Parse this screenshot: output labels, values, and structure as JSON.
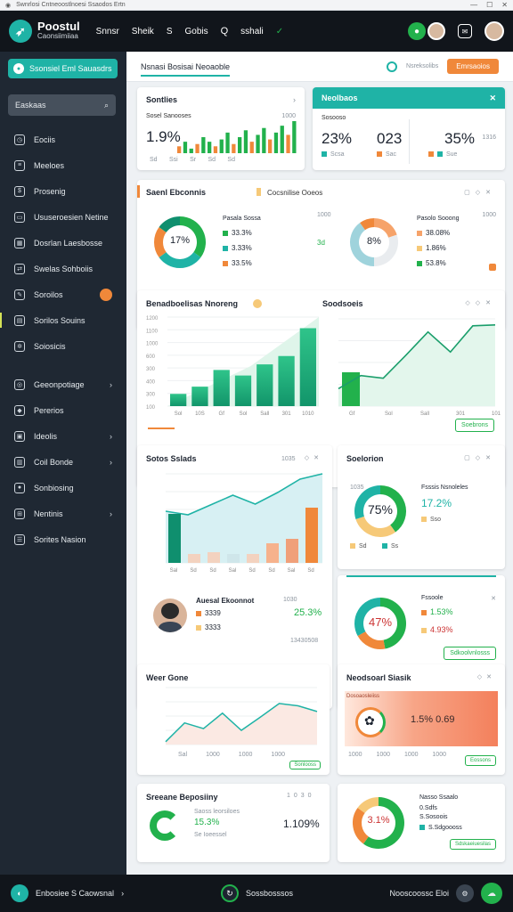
{
  "window": {
    "title": "Swnrlosi Cntneoostlnoesi Ssaodos Ertn"
  },
  "topbar": {
    "brand_name": "Poostul",
    "brand_sub": "Caonsiimiiaa",
    "nav": [
      "Snnsr",
      "Sheik",
      "S",
      "Gobis",
      "Q",
      "sshali"
    ],
    "check": "✓"
  },
  "sidebar": {
    "primary_label": "Ssonsiel Eml Sauasdrs",
    "search_placeholder": "Easkaas",
    "items": [
      {
        "label": "Eociis",
        "icon": "history-icon"
      },
      {
        "label": "Meeloes",
        "icon": "document-icon"
      },
      {
        "label": "Prosenig",
        "icon": "wallet-icon"
      },
      {
        "label": "Ususeroesien Netine",
        "icon": "monitor-icon"
      },
      {
        "label": "Dosrlan Laesbosse",
        "icon": "calendar-icon"
      },
      {
        "label": "Swelas Sohboiis",
        "icon": "share-icon"
      },
      {
        "label": "Soroilos",
        "icon": "chat-icon"
      },
      {
        "label": "Sorilos Souins",
        "icon": "folder-icon"
      },
      {
        "label": "Soiosicis",
        "icon": "gear-icon"
      }
    ],
    "items2": [
      {
        "label": "Geeonpotiage",
        "icon": "globe-icon"
      },
      {
        "label": "Pererios",
        "icon": "tag-icon"
      },
      {
        "label": "Ideolis",
        "icon": "image-icon"
      },
      {
        "label": "Coil Bonde",
        "icon": "clipboard-icon"
      },
      {
        "label": "Sonbiosing",
        "icon": "camera-icon"
      },
      {
        "label": "Nentinis",
        "icon": "grid-icon"
      },
      {
        "label": "Sorites Nasion",
        "icon": "list-icon"
      }
    ]
  },
  "header": {
    "title": "Nsnasi Bosisai Neoaoble",
    "button": "Emrsaoios",
    "toggle": "Nsreksolibs"
  },
  "cards": {
    "c1": {
      "title": "Sontlies",
      "value": "1.9%",
      "sub": "Sosel Sanooses",
      "tick": "1000",
      "labels": [
        "Sd",
        "Ssi",
        "Sr",
        "Sd",
        "Sd"
      ]
    },
    "c2": {
      "title": "Neolbaos",
      "sub": "Sosooso",
      "v1": "23%",
      "v2": "023",
      "v3": "35%",
      "tick": "1316",
      "legend": [
        "Scsa",
        "Sac",
        "Sue"
      ]
    },
    "c3": {
      "title": "Saenl Ebconnis",
      "title2": "Cocsnilise Ooeos",
      "donut1_value": "17%",
      "donut2_value": "8%",
      "d1_head": "Pasala Sossa",
      "d1_rows": [
        "33.3%",
        "3.33%",
        "33.5%"
      ],
      "d2_head": "Pasolo Sooong",
      "d2_rows": [
        "38.08%",
        "1.86%",
        "53.8%"
      ],
      "mid": "3d",
      "badge_a": "1000",
      "badge_b": "1000"
    },
    "c4": {
      "title": "Benadboelisas Nnoreng",
      "title2": "Soodsoeis",
      "btn": "Soebrons",
      "labels": [
        "Sol",
        "10S",
        "Gf",
        "Sol",
        "Sall",
        "301",
        "1010"
      ],
      "axis": [
        "1200",
        "1100",
        "1000",
        "600",
        "300",
        "400",
        "300",
        "100"
      ]
    },
    "c5": {
      "title": "Sotos Sslads",
      "tick": "1035",
      "labels": [
        "Sal",
        "Sd",
        "Sd",
        "Sal",
        "Sd",
        "Sd",
        "Sal",
        "Sd"
      ],
      "person_title": "Auesal Ekoonnot",
      "person_rows": [
        "3339",
        "3333"
      ],
      "person_value": "25.3%",
      "person_tick": "1030",
      "footer": "13430508"
    },
    "c6": {
      "title": "Soelorion",
      "donut_value": "75%",
      "head": "Fsssis Nsnoleles",
      "value": "17.2%",
      "tick": "1035",
      "badges": [
        "Sd",
        "Ss",
        "Sso"
      ]
    },
    "c7": {
      "donut_value": "47%",
      "head": "Fssoole",
      "rows": [
        "1.53%",
        "4.93%"
      ],
      "btn": "Sdkoolvnlosss"
    },
    "c8": {
      "title": "Weer Gone",
      "labels": [
        "Sal",
        "1000",
        "1000",
        "1000",
        "1000"
      ],
      "btn": "Sonlooss",
      "ticks": [
        "1000",
        "1000",
        "1000",
        "1000",
        "1000"
      ]
    },
    "c9": {
      "title": "Neodsoarl Siasik",
      "head": "Dosoaosleiiss",
      "value": "1.5% 0.69",
      "labels": [
        "1000",
        "1000",
        "1000",
        "1000"
      ],
      "btn": "Eossons"
    },
    "c10": {
      "title": "Sreeane Beposiiny",
      "value": "1.109%",
      "rows": [
        "15.3%",
        "Se Ioeessel"
      ],
      "sub": "Saoss leorsiloes",
      "tick": "1030"
    },
    "c11": {
      "donut_value": "3.1%",
      "head": "Nasso Ssaalo",
      "rows": [
        "0.Sdfs",
        "S.Sosoois",
        "S.Sdgoooss"
      ],
      "btn": "Sdskaeiuesilas"
    }
  },
  "footer": {
    "left": "Enbosiee S Caowsnal",
    "mid": "Sossbosssos",
    "right": "Nooscoossc Eloi"
  },
  "chart_data": [
    {
      "type": "bar",
      "title": "Sontlies",
      "values": [
        3,
        5,
        2,
        4,
        7,
        5,
        3,
        6,
        9,
        4,
        7,
        10,
        5,
        8,
        11,
        6,
        9,
        12,
        8,
        14
      ],
      "ylim": [
        0,
        14
      ]
    },
    {
      "type": "bar",
      "title": "Benadboelisas Nnoreng",
      "categories": [
        "Sol",
        "10S",
        "Gf",
        "Sol",
        "Sall",
        "301",
        "1010"
      ],
      "values": [
        2.2,
        3.5,
        6.5,
        5.5,
        7.5,
        9.0,
        14.0
      ],
      "ylim": [
        0,
        16
      ]
    },
    {
      "type": "line",
      "title": "Soodsoeis",
      "values": [
        20,
        35,
        32,
        58,
        85,
        62,
        92,
        93
      ],
      "ylim": [
        0,
        100
      ]
    },
    {
      "type": "area",
      "title": "Sotos Sslads",
      "values": [
        58,
        54,
        65,
        76,
        66,
        79,
        94,
        100
      ],
      "bars": [
        55,
        10,
        12,
        10,
        10,
        22,
        27,
        62
      ],
      "ylim": [
        0,
        100
      ]
    },
    {
      "type": "line",
      "title": "Weer Gone",
      "values": [
        5,
        38,
        28,
        55,
        25,
        48,
        72,
        68,
        58
      ],
      "ylim": [
        0,
        100
      ]
    },
    {
      "type": "pie",
      "title": "Saenl Ebconnis",
      "values": [
        35,
        30,
        20,
        15
      ]
    },
    {
      "type": "pie",
      "title": "Cocsnilise Ooeos",
      "values": [
        20,
        30,
        40,
        10
      ]
    },
    {
      "type": "pie",
      "title": "Soelorion",
      "values": [
        40,
        30,
        30
      ]
    },
    {
      "type": "pie",
      "values": [
        47,
        20,
        33
      ]
    },
    {
      "type": "pie",
      "values": [
        60,
        25,
        15
      ]
    }
  ]
}
